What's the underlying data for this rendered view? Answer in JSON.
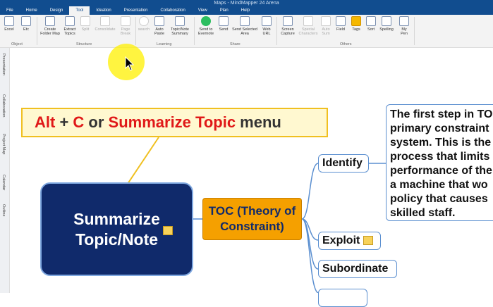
{
  "window": {
    "title": "Maps - MindMapper 24 Arena"
  },
  "tabs": [
    "File",
    "Home",
    "Design",
    "Tool",
    "Ideation",
    "Presentation",
    "Collaboration",
    "View",
    "Plan",
    "Help"
  ],
  "ribbon": {
    "buttons": [
      {
        "label": "Excel",
        "enabled": true
      },
      {
        "label": "Etc",
        "enabled": true
      },
      {
        "label": "Create Folder Map",
        "enabled": true
      },
      {
        "label": "Extract Topics",
        "enabled": true
      },
      {
        "label": "Split",
        "enabled": false
      },
      {
        "label": "Consolidate",
        "enabled": false
      },
      {
        "label": "Page Break",
        "enabled": false
      },
      {
        "label": "search",
        "enabled": false
      },
      {
        "label": "Auto Paste",
        "enabled": true
      },
      {
        "label": "Topic/Note Summary",
        "enabled": true
      },
      {
        "label": "Send to Evernote",
        "enabled": true
      },
      {
        "label": "Send",
        "enabled": true
      },
      {
        "label": "Send Selected Area",
        "enabled": true
      },
      {
        "label": "Web URL",
        "enabled": true
      },
      {
        "label": "Screen Capture",
        "enabled": true
      },
      {
        "label": "Special Characters",
        "enabled": false
      },
      {
        "label": "Auto Sum",
        "enabled": false
      },
      {
        "label": "Field",
        "enabled": true
      },
      {
        "label": "Tags",
        "enabled": true
      },
      {
        "label": "Sort",
        "enabled": true
      },
      {
        "label": "Spelling",
        "enabled": true
      },
      {
        "label": "My Pen",
        "enabled": true
      }
    ],
    "groups": [
      "Object",
      "Structure",
      "Learning",
      "Share",
      "Others"
    ]
  },
  "side_panel": [
    "Presentation",
    "Collaboration",
    "Project Map",
    "Calendar",
    "Outline"
  ],
  "callout": {
    "p1": "Alt",
    "p2": " + ",
    "p3": "C",
    "p4": " or ",
    "p5": "Summarize Topic",
    "p6": " menu"
  },
  "map": {
    "central": "Summarize Topic/Note",
    "main_topic": "TOC (Theory of Constraint)",
    "subtopics": [
      "Identify",
      "Exploit",
      "Subordinate"
    ],
    "note_lines": [
      "The first step in TOC",
      "primary constraint",
      "system. This is the",
      "process that limits",
      "performance of the",
      "a machine that wo",
      "policy that causes",
      "skilled staff."
    ]
  }
}
